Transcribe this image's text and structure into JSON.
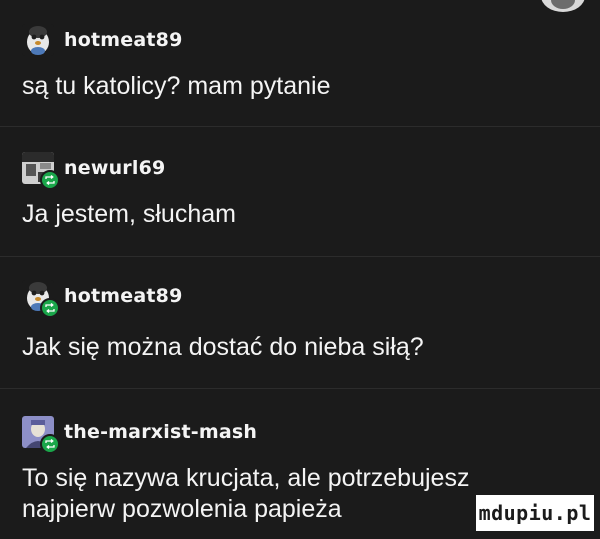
{
  "posts": [
    {
      "username": "hotmeat89",
      "avatar_icon": "penguin-avatar-icon",
      "badge": false,
      "text": "są tu katolicy? mam pytanie"
    },
    {
      "username": "newurl69",
      "avatar_icon": "photo-avatar-icon",
      "badge": true,
      "text": "Ja jestem, słucham"
    },
    {
      "username": "hotmeat89",
      "avatar_icon": "penguin-avatar-icon",
      "badge": true,
      "text": "Jak się można dostać do nieba siłą?"
    },
    {
      "username": "the-marxist-mash",
      "avatar_icon": "portrait-avatar-icon",
      "badge": true,
      "text_lines": [
        "To się nazywa krucjata, ale potrzebujesz",
        "najpierw pozwolenia papieża"
      ]
    }
  ],
  "badge_icon": "reblog-icon",
  "watermark": "mdupiu.pl",
  "colors": {
    "background": "#1b1b1b",
    "text": "#f4f4f4",
    "badge": "#1aa64a",
    "divider": "#2c2c2c"
  }
}
